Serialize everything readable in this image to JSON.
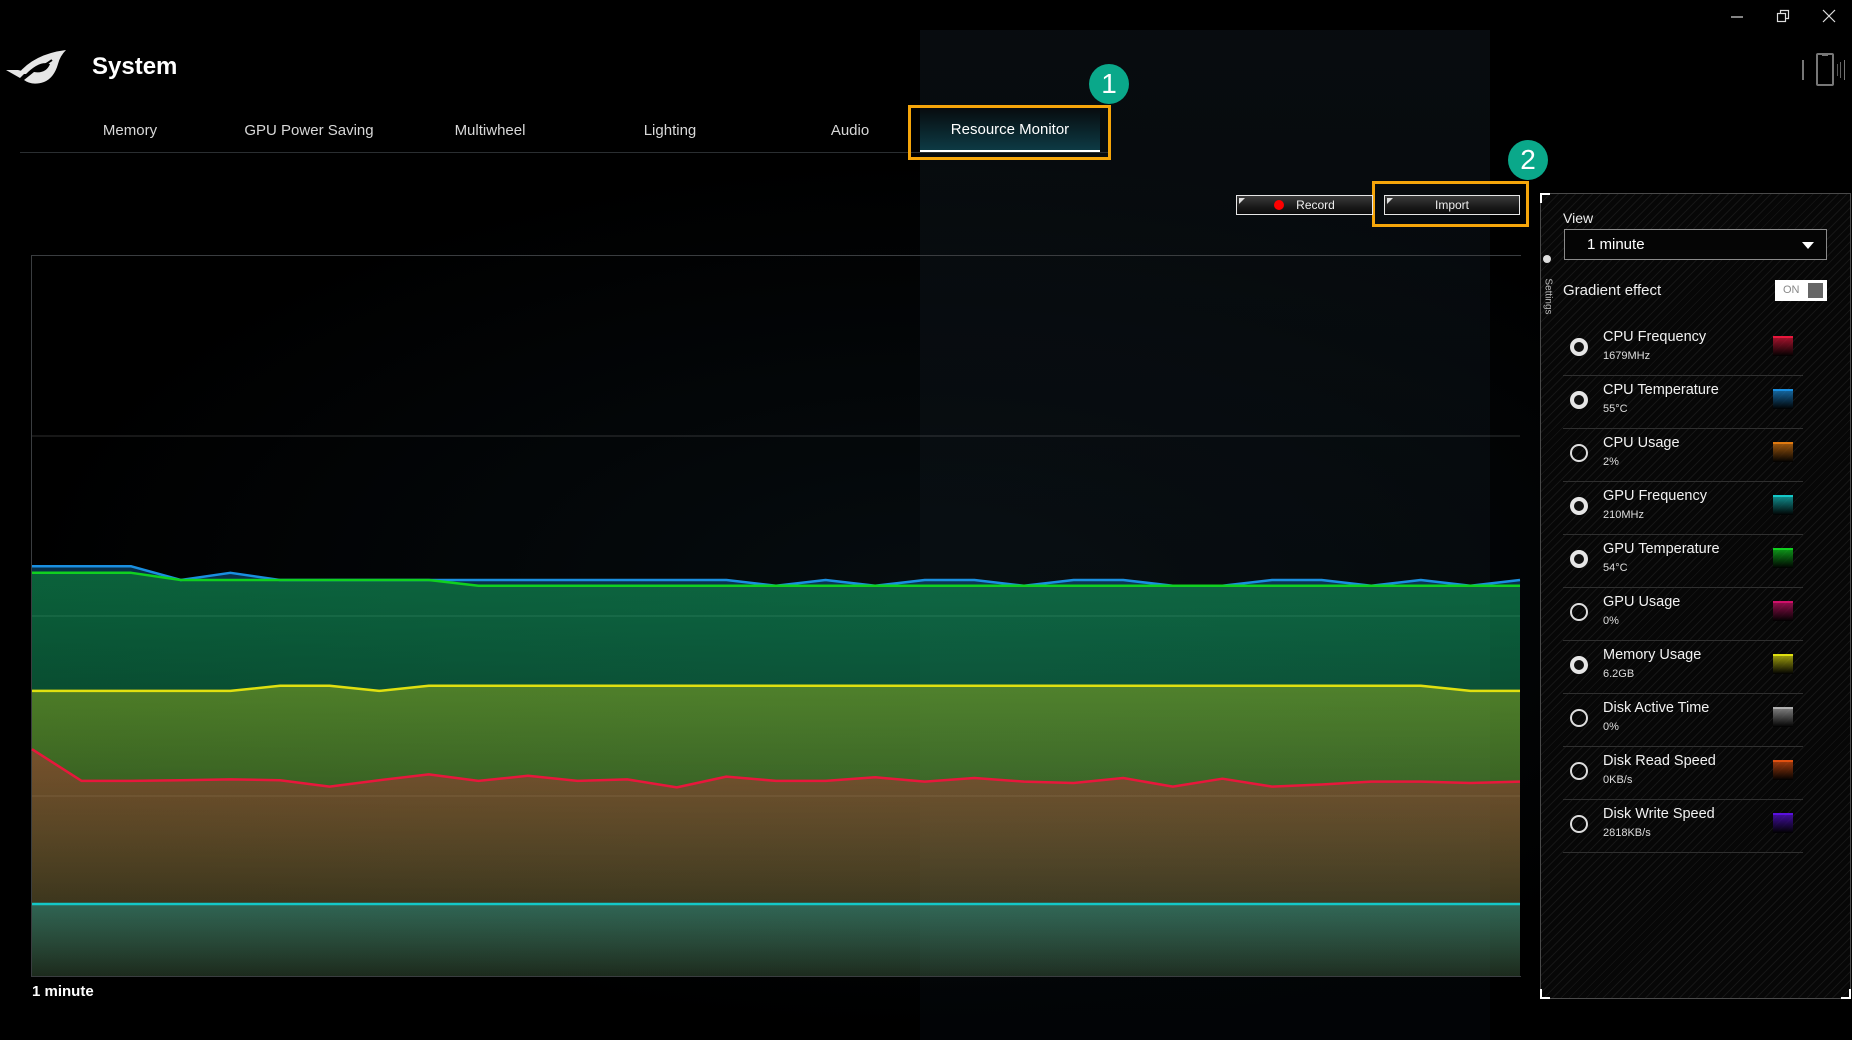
{
  "window": {
    "controls": [
      {
        "name": "minimize",
        "glyph": "minimize-icon"
      },
      {
        "name": "restore",
        "glyph": "restore-icon"
      },
      {
        "name": "close",
        "glyph": "close-icon"
      }
    ]
  },
  "header": {
    "logo": "rog-logo",
    "title": "System",
    "device_icon": "phone-device-icon"
  },
  "tabs": [
    {
      "label": "Memory",
      "active": false
    },
    {
      "label": "GPU Power Saving",
      "active": false
    },
    {
      "label": "Multiwheel",
      "active": false
    },
    {
      "label": "Lighting",
      "active": false
    },
    {
      "label": "Audio",
      "active": false
    },
    {
      "label": "Resource Monitor",
      "active": true
    }
  ],
  "callouts": [
    {
      "number": "1",
      "target": "Resource Monitor tab"
    },
    {
      "number": "2",
      "target": "Import button"
    }
  ],
  "toolbar": {
    "record_label": "Record",
    "import_label": "Import"
  },
  "settings": {
    "tab_label": "Settings",
    "view_label": "View",
    "view_value": "1 minute",
    "gradient_label": "Gradient effect",
    "gradient_state": "ON",
    "metrics": [
      {
        "name": "CPU Frequency",
        "value": "1679MHz",
        "selected": true,
        "color": "#e8173c"
      },
      {
        "name": "CPU Temperature",
        "value": "55°C",
        "selected": true,
        "color": "#1a8fe0"
      },
      {
        "name": "CPU Usage",
        "value": "2%",
        "selected": false,
        "color": "#e07a10"
      },
      {
        "name": "GPU Frequency",
        "value": "210MHz",
        "selected": true,
        "color": "#14c8c8"
      },
      {
        "name": "GPU Temperature",
        "value": "54°C",
        "selected": true,
        "color": "#10d020"
      },
      {
        "name": "GPU Usage",
        "value": "0%",
        "selected": false,
        "color": "#d0106a"
      },
      {
        "name": "Memory Usage",
        "value": "6.2GB",
        "selected": true,
        "color": "#e0e010"
      },
      {
        "name": "Disk Active Time",
        "value": "0%",
        "selected": false,
        "color": "#b0b0b0"
      },
      {
        "name": "Disk Read Speed",
        "value": "0KB/s",
        "selected": false,
        "color": "#e05010"
      },
      {
        "name": "Disk Write Speed",
        "value": "2818KB/s",
        "selected": false,
        "color": "#5a10e0"
      }
    ]
  },
  "chart_caption": "1 minute",
  "chart_data": {
    "type": "area",
    "title": "",
    "xlabel": "1 minute",
    "ylabel": "",
    "x_points": 31,
    "ylim": [
      0,
      100
    ],
    "y_units": "percent of chart height (no numeric axis shown)",
    "grid": true,
    "grid_lines_y": [
      25,
      50,
      75
    ],
    "legend": "right-panel",
    "series": [
      {
        "name": "CPU Temperature",
        "color": "#1a8fe0",
        "values": [
          56.9,
          56.9,
          56.9,
          55.0,
          56.0,
          55.0,
          55.0,
          55.0,
          55.0,
          55.0,
          55.0,
          55.0,
          55.0,
          55.0,
          55.0,
          54.2,
          55.0,
          54.2,
          55.0,
          55.0,
          54.2,
          55.0,
          55.0,
          54.2,
          54.2,
          55.0,
          55.0,
          54.2,
          55.0,
          54.2,
          55.0
        ]
      },
      {
        "name": "GPU Temperature",
        "color": "#10d020",
        "values": [
          56.0,
          56.0,
          56.0,
          55.0,
          55.0,
          55.0,
          55.0,
          55.0,
          55.0,
          54.2,
          54.2,
          54.2,
          54.2,
          54.2,
          54.2,
          54.2,
          54.2,
          54.2,
          54.2,
          54.2,
          54.2,
          54.2,
          54.2,
          54.2,
          54.2,
          54.2,
          54.2,
          54.2,
          54.2,
          54.2,
          54.2
        ]
      },
      {
        "name": "Memory Usage",
        "color": "#e0e010",
        "values": [
          39.6,
          39.6,
          39.6,
          39.6,
          39.6,
          40.3,
          40.3,
          39.6,
          40.3,
          40.3,
          40.3,
          40.3,
          40.3,
          40.3,
          40.3,
          40.3,
          40.3,
          40.3,
          40.3,
          40.3,
          40.3,
          40.3,
          40.3,
          40.3,
          40.3,
          40.3,
          40.3,
          40.3,
          40.3,
          39.6,
          39.6
        ]
      },
      {
        "name": "CPU Frequency",
        "color": "#e8173c",
        "values": [
          31.5,
          27.1,
          27.1,
          27.2,
          27.3,
          27.2,
          26.3,
          27.2,
          28.0,
          27.1,
          27.8,
          27.1,
          27.3,
          26.2,
          27.7,
          27.1,
          27.1,
          27.6,
          27.0,
          27.5,
          27.0,
          26.8,
          27.5,
          26.3,
          27.4,
          26.3,
          26.6,
          27.0,
          27.0,
          26.8,
          27.0
        ]
      },
      {
        "name": "GPU Frequency",
        "color": "#14c8c8",
        "values": [
          10.0,
          10.0,
          10.0,
          10.0,
          10.0,
          10.0,
          10.0,
          10.0,
          10.0,
          10.0,
          10.0,
          10.0,
          10.0,
          10.0,
          10.0,
          10.0,
          10.0,
          10.0,
          10.0,
          10.0,
          10.0,
          10.0,
          10.0,
          10.0,
          10.0,
          10.0,
          10.0,
          10.0,
          10.0,
          10.0,
          10.0
        ]
      }
    ]
  }
}
